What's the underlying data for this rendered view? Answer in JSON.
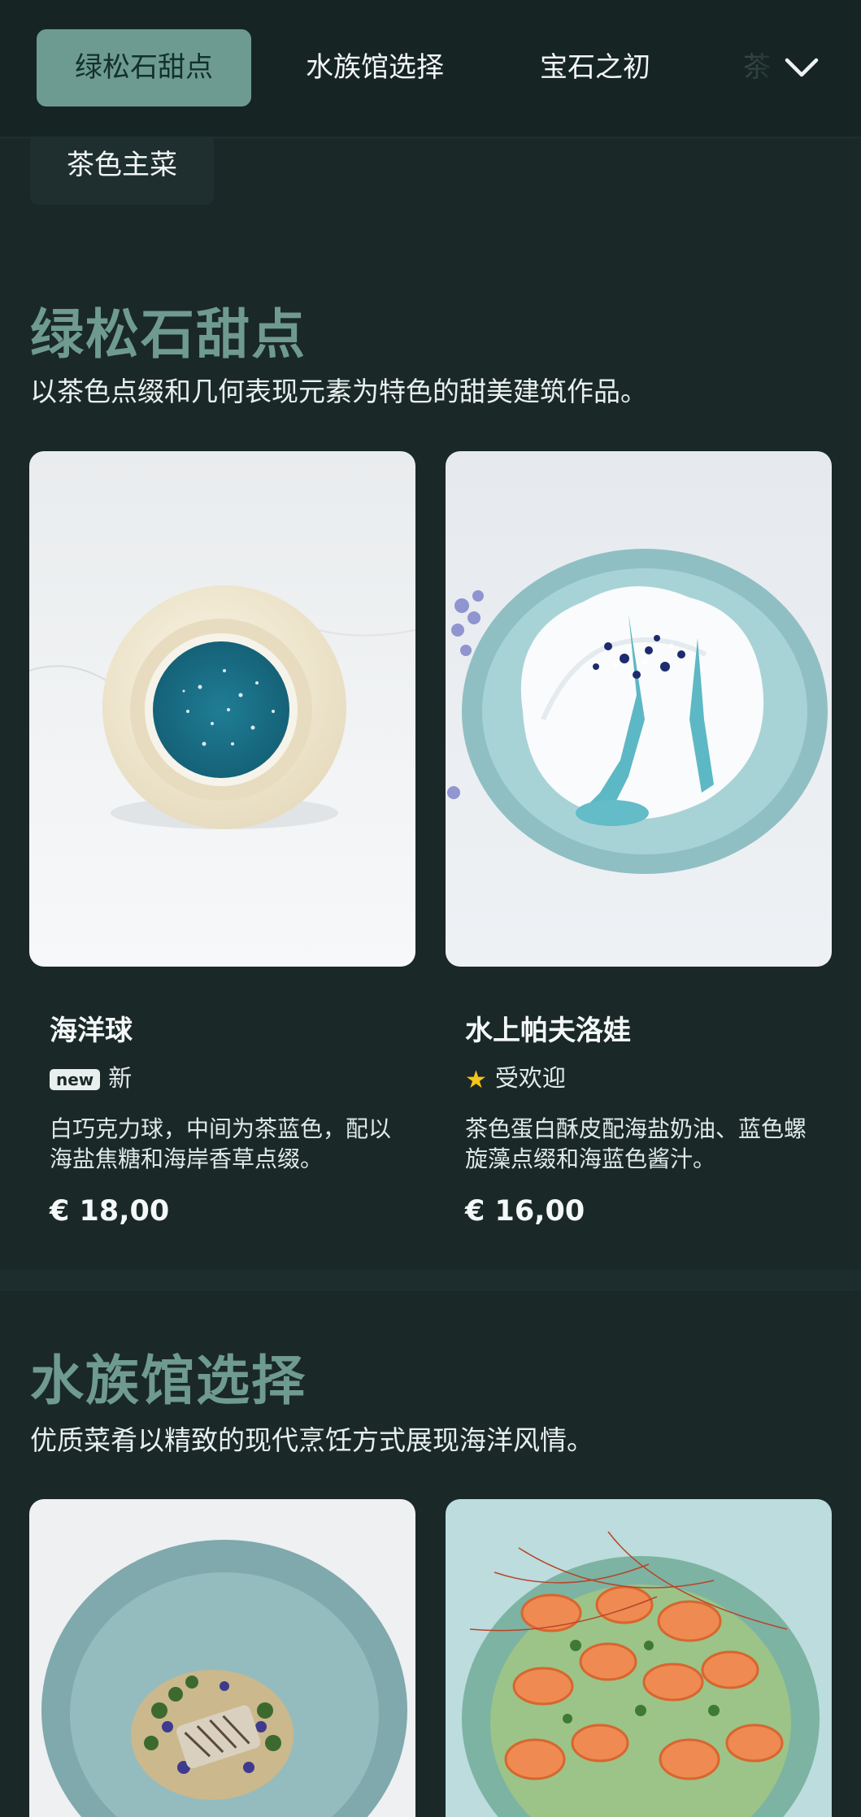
{
  "nav": {
    "tabs": [
      {
        "label": "绿松石甜点",
        "active": true
      },
      {
        "label": "水族馆选择",
        "active": false
      },
      {
        "label": "宝石之初",
        "active": false
      },
      {
        "label": "茶",
        "active": false
      }
    ],
    "secondary_tab": "茶色主菜",
    "expand_icon": "chevron-down-icon"
  },
  "sections": [
    {
      "title": "绿松石甜点",
      "description": "以茶色点缀和几何表现元素为特色的甜美建筑作品。",
      "items": [
        {
          "name": "海洋球",
          "badge_icon": "new",
          "badge_label": "新",
          "description": "白巧克力球，中间为茶蓝色，配以海盐焦糖和海岸香草点缀。",
          "price": "€ 18,00"
        },
        {
          "name": "水上帕夫洛娃",
          "badge_icon": "star-icon",
          "badge_label": "受欢迎",
          "description": "茶色蛋白酥皮配海盐奶油、蓝色螺旋藻点缀和海蓝色酱汁。",
          "price": "€ 16,00"
        }
      ]
    },
    {
      "title": "水族馆选择",
      "description": "优质菜肴以精致的现代烹饪方式展现海洋风情。",
      "items": []
    }
  ],
  "colors": {
    "background": "#1a2828",
    "accent": "#6d9b92",
    "title": "#6f9a90",
    "star": "#f5c518"
  }
}
